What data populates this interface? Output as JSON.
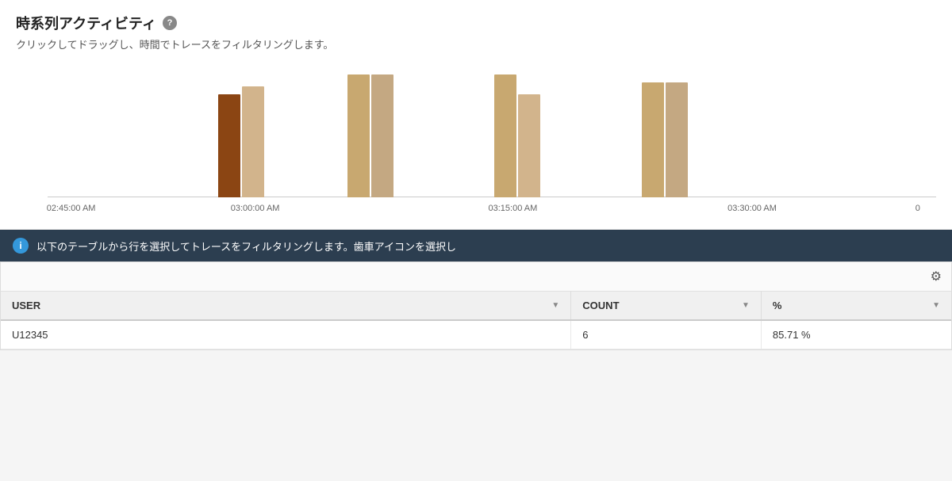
{
  "timeseries": {
    "title": "時系列アクティビティ",
    "subtitle": "クリックしてドラッグし、時間でトレースをフィルタリングします。",
    "info_icon_label": "?",
    "x_labels": [
      "02:45:00 AM",
      "03:00:00 AM",
      "03:15:00 AM",
      "03:30:00 AM",
      "0"
    ],
    "bars": [
      {
        "group": 1,
        "left_pct": 22,
        "height1": 130,
        "height2": 140,
        "color1": "bar-brown",
        "color2": "bar-tan"
      },
      {
        "group": 2,
        "left_pct": 38,
        "height1": 155,
        "height2": 155,
        "color1": "bar-wheat",
        "color2": "bar-khaki"
      },
      {
        "group": 3,
        "left_pct": 54,
        "height1": 155,
        "height2": 130,
        "color1": "bar-wheat",
        "color2": "bar-tan"
      },
      {
        "group": 4,
        "left_pct": 70,
        "height1": 145,
        "height2": 145,
        "color1": "bar-wheat",
        "color2": "bar-khaki"
      }
    ]
  },
  "info_banner": {
    "icon_label": "i",
    "text": "以下のテーブルから行を選択してトレースをフィルタリングします。歯車アイコンを選択し"
  },
  "table": {
    "gear_icon": "⚙",
    "columns": [
      {
        "key": "user",
        "label": "USER"
      },
      {
        "key": "count",
        "label": "COUNT"
      },
      {
        "key": "pct",
        "label": "%"
      }
    ],
    "rows": [
      {
        "user": "U12345",
        "count": "6",
        "pct": "85.71 %"
      }
    ]
  }
}
